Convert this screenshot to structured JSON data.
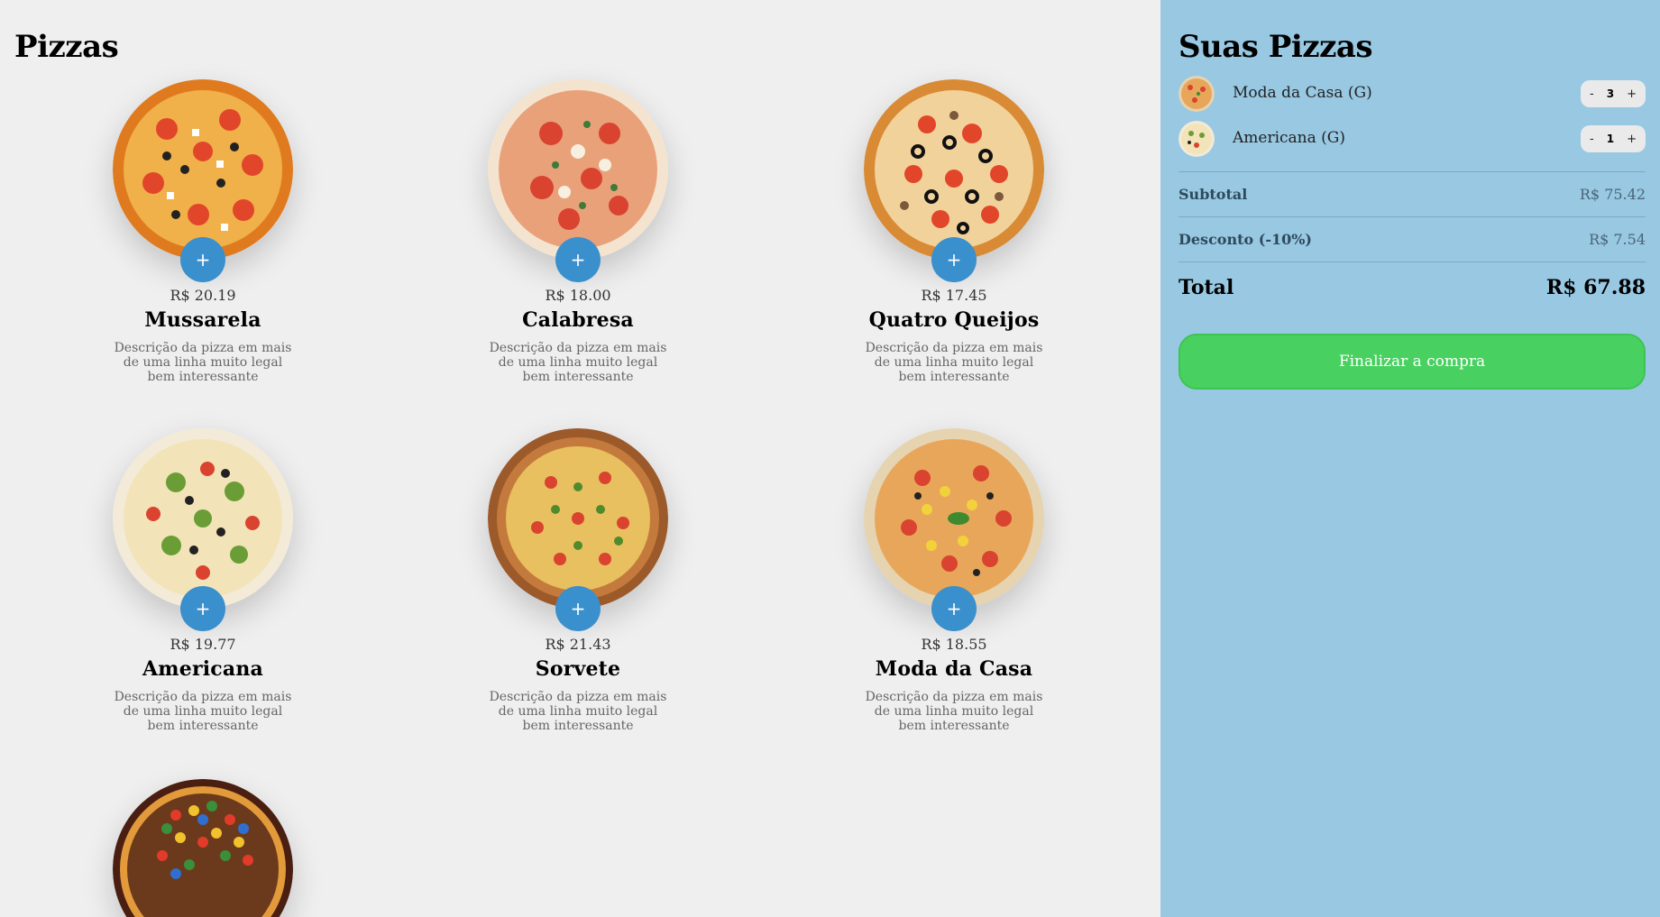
{
  "header": {
    "title": "Pizzas"
  },
  "pizzas": [
    {
      "name": "Mussarela",
      "price": "R$ 20.19",
      "description": "Descrição da pizza em mais de uma linha muito legal bem interessante",
      "add_label": "+"
    },
    {
      "name": "Calabresa",
      "price": "R$ 18.00",
      "description": "Descrição da pizza em mais de uma linha muito legal bem interessante",
      "add_label": "+"
    },
    {
      "name": "Quatro Queijos",
      "price": "R$ 17.45",
      "description": "Descrição da pizza em mais de uma linha muito legal bem interessante",
      "add_label": "+"
    },
    {
      "name": "Americana",
      "price": "R$ 19.77",
      "description": "Descrição da pizza em mais de uma linha muito legal bem interessante",
      "add_label": "+"
    },
    {
      "name": "Sorvete",
      "price": "R$ 21.43",
      "description": "Descrição da pizza em mais de uma linha muito legal bem interessante",
      "add_label": "+"
    },
    {
      "name": "Moda da Casa",
      "price": "R$ 18.55",
      "description": "Descrição da pizza em mais de uma linha muito legal bem interessante",
      "add_label": "+"
    }
  ],
  "cart": {
    "title": "Suas Pizzas",
    "items": [
      {
        "name": "Moda da Casa (G)",
        "qty": "3",
        "minus": "-",
        "plus": "+"
      },
      {
        "name": "Americana (G)",
        "qty": "1",
        "minus": "-",
        "plus": "+"
      }
    ],
    "subtotal_label": "Subtotal",
    "subtotal_value": "R$ 75.42",
    "discount_label": "Desconto (-10%)",
    "discount_value": "R$ 7.54",
    "total_label": "Total",
    "total_value": "R$ 67.88",
    "checkout_label": "Finalizar a compra"
  },
  "colors": {
    "accent": "#3a8fcd",
    "sidebar_bg": "#98c8e2",
    "checkout": "#48d160",
    "page_bg": "#efefef"
  }
}
